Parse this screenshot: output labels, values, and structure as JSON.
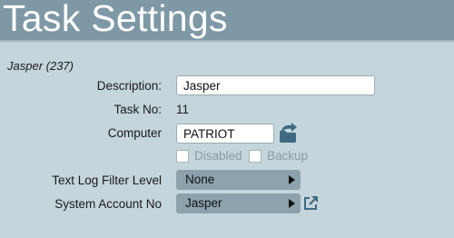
{
  "window": {
    "title": "Task Settings"
  },
  "task": {
    "heading": "Jasper (237)",
    "description_label": "Description:",
    "description_value": "Jasper",
    "task_no_label": "Task No:",
    "task_no_value": "11",
    "computer_label": "Computer",
    "computer_value": "PATRIOT",
    "disabled_label": "Disabled",
    "backup_label": "Backup",
    "log_filter_label": "Text Log Filter Level",
    "log_filter_value": "None",
    "system_account_label": "System Account No",
    "system_account_value": "Jasper"
  },
  "colors": {
    "header": "#7e98a6",
    "background": "#c5d5dc",
    "dropdown": "#8da2ad",
    "icon": "#3f6a82"
  },
  "icons": {
    "computer_picker": "folder-arrow-icon",
    "open_account": "external-link-icon"
  }
}
